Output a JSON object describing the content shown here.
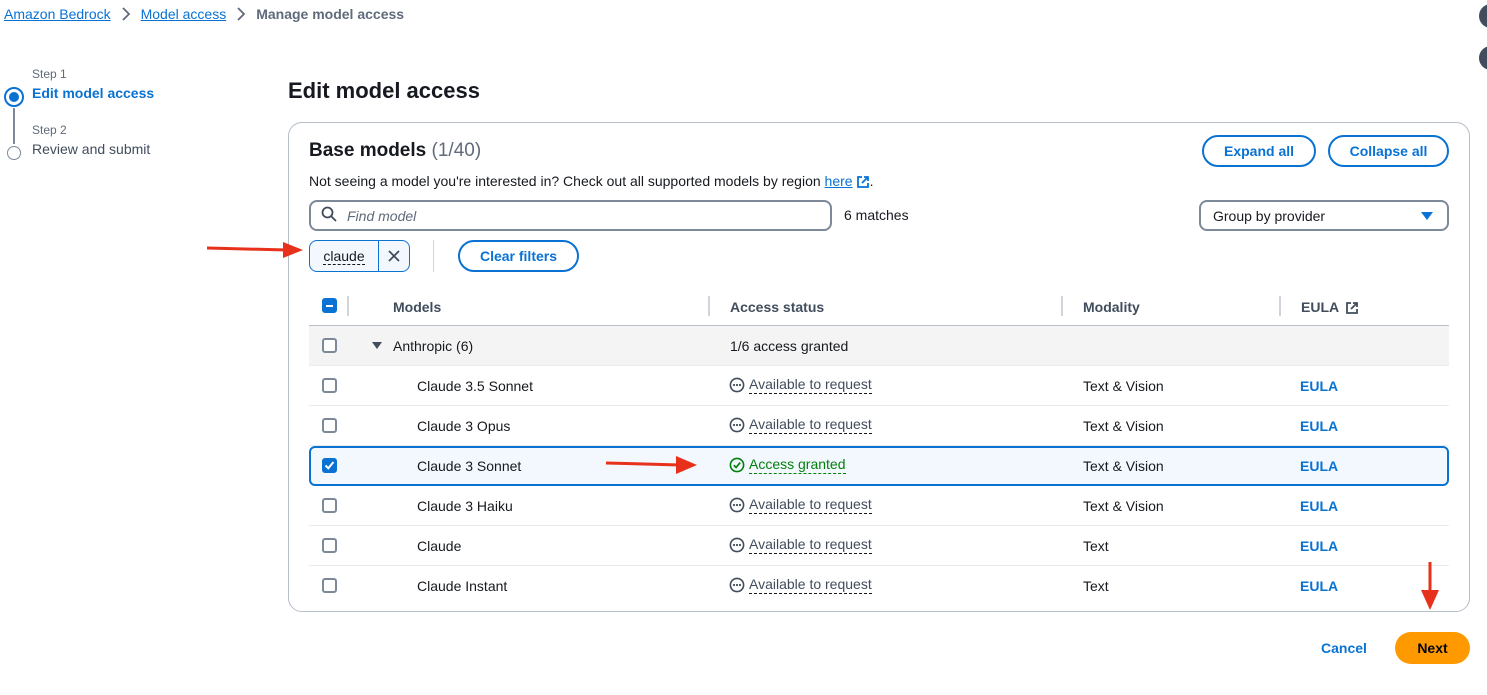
{
  "breadcrumb": {
    "item1": "Amazon Bedrock",
    "item2": "Model access",
    "current": "Manage model access"
  },
  "steps": [
    {
      "num": "Step 1",
      "title": "Edit model access"
    },
    {
      "num": "Step 2",
      "title": "Review and submit"
    }
  ],
  "page_title": "Edit model access",
  "base_models": {
    "title": "Base models",
    "count": "(1/40)"
  },
  "hint": {
    "text": "Not seeing a model you're interested in? Check out all supported models by region ",
    "link": "here",
    "suffix": "."
  },
  "buttons": {
    "expand_all": "Expand all",
    "collapse_all": "Collapse all",
    "clear_filters": "Clear filters",
    "cancel": "Cancel",
    "next": "Next"
  },
  "search": {
    "placeholder": "Find model",
    "matches": "6 matches"
  },
  "group_select": {
    "value": "Group by provider"
  },
  "filter_token": "claude",
  "table": {
    "headers": {
      "models": "Models",
      "access_status": "Access status",
      "modality": "Modality",
      "eula": "EULA"
    },
    "group": {
      "name": "Anthropic (6)",
      "summary": "1/6 access granted"
    },
    "rows": [
      {
        "model": "Claude 3.5 Sonnet",
        "status": "Available to request",
        "modality": "Text & Vision",
        "eula": "EULA",
        "checked": false
      },
      {
        "model": "Claude 3 Opus",
        "status": "Available to request",
        "modality": "Text & Vision",
        "eula": "EULA",
        "checked": false
      },
      {
        "model": "Claude 3 Sonnet",
        "status": "Access granted",
        "modality": "Text & Vision",
        "eula": "EULA",
        "checked": true
      },
      {
        "model": "Claude 3 Haiku",
        "status": "Available to request",
        "modality": "Text & Vision",
        "eula": "EULA",
        "checked": false
      },
      {
        "model": "Claude",
        "status": "Available to request",
        "modality": "Text",
        "eula": "EULA",
        "checked": false
      },
      {
        "model": "Claude Instant",
        "status": "Available to request",
        "modality": "Text",
        "eula": "EULA",
        "checked": false
      }
    ]
  },
  "colors": {
    "accent": "#0972d3",
    "primary_button": "#ff9900",
    "granted": "#037f0c",
    "annotation_arrow": "#e8311a"
  },
  "icons": [
    "chevron-right-icon",
    "search-icon",
    "close-icon",
    "external-link-icon",
    "caret-down-icon",
    "ellipsis-circle-icon",
    "check-circle-icon"
  ]
}
